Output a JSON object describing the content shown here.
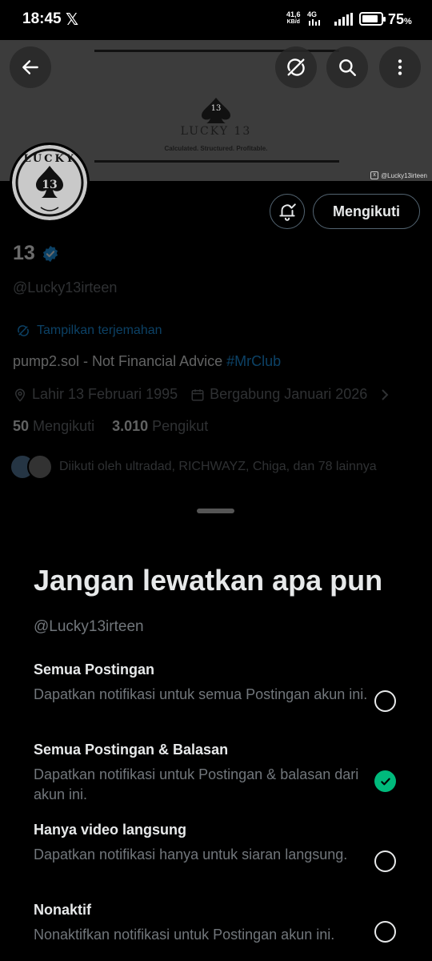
{
  "status_bar": {
    "time": "18:45",
    "x_logo": "𝕏",
    "net_rate_top": "41,6",
    "net_rate_bottom": "KB/d",
    "network": "4G",
    "battery": "75",
    "battery_unit": "%"
  },
  "banner": {
    "logo_number": "13",
    "title": "LUCKY 13",
    "subtitle": "Calculated. Structured. Profitable.",
    "watermark": "@Lucky13irteen"
  },
  "avatar": {
    "text": "LUCKY",
    "number": "13"
  },
  "actions": {
    "follow_label": "Mengikuti"
  },
  "profile": {
    "name": "13",
    "handle": "@Lucky13irteen",
    "translate_label": "Tampilkan terjemahan",
    "bio_text": "pump2.sol - Not Financial Advice ",
    "bio_hashtag": "#MrClub",
    "birth": "Lahir 13 Februari 1995",
    "joined": "Bergabung Januari 2026",
    "following_count": "50",
    "following_label": "Mengikuti",
    "followers_count": "3.010",
    "followers_label": "Pengikut",
    "followed_by": "Diikuti oleh ultradad, RICHWAYZ, Chiga, dan 78 lainnya"
  },
  "sheet": {
    "title": "Jangan lewatkan apa pun",
    "handle": "@Lucky13irteen",
    "options": [
      {
        "title": "Semua Postingan",
        "desc": "Dapatkan notifikasi untuk semua Postingan akun ini.",
        "selected": false
      },
      {
        "title": "Semua Postingan & Balasan",
        "desc": "Dapatkan notifikasi untuk Postingan & balasan dari akun ini.",
        "selected": true
      },
      {
        "title": "Hanya video langsung",
        "desc": "Dapatkan notifikasi hanya untuk siaran langsung.",
        "selected": false
      },
      {
        "title": "Nonaktif",
        "desc": "Nonaktifkan notifikasi untuk Postingan akun ini.",
        "selected": false
      }
    ]
  },
  "colors": {
    "accent_blue": "#1d9bf0",
    "check_green": "#00ba7c",
    "muted": "#71767b"
  }
}
